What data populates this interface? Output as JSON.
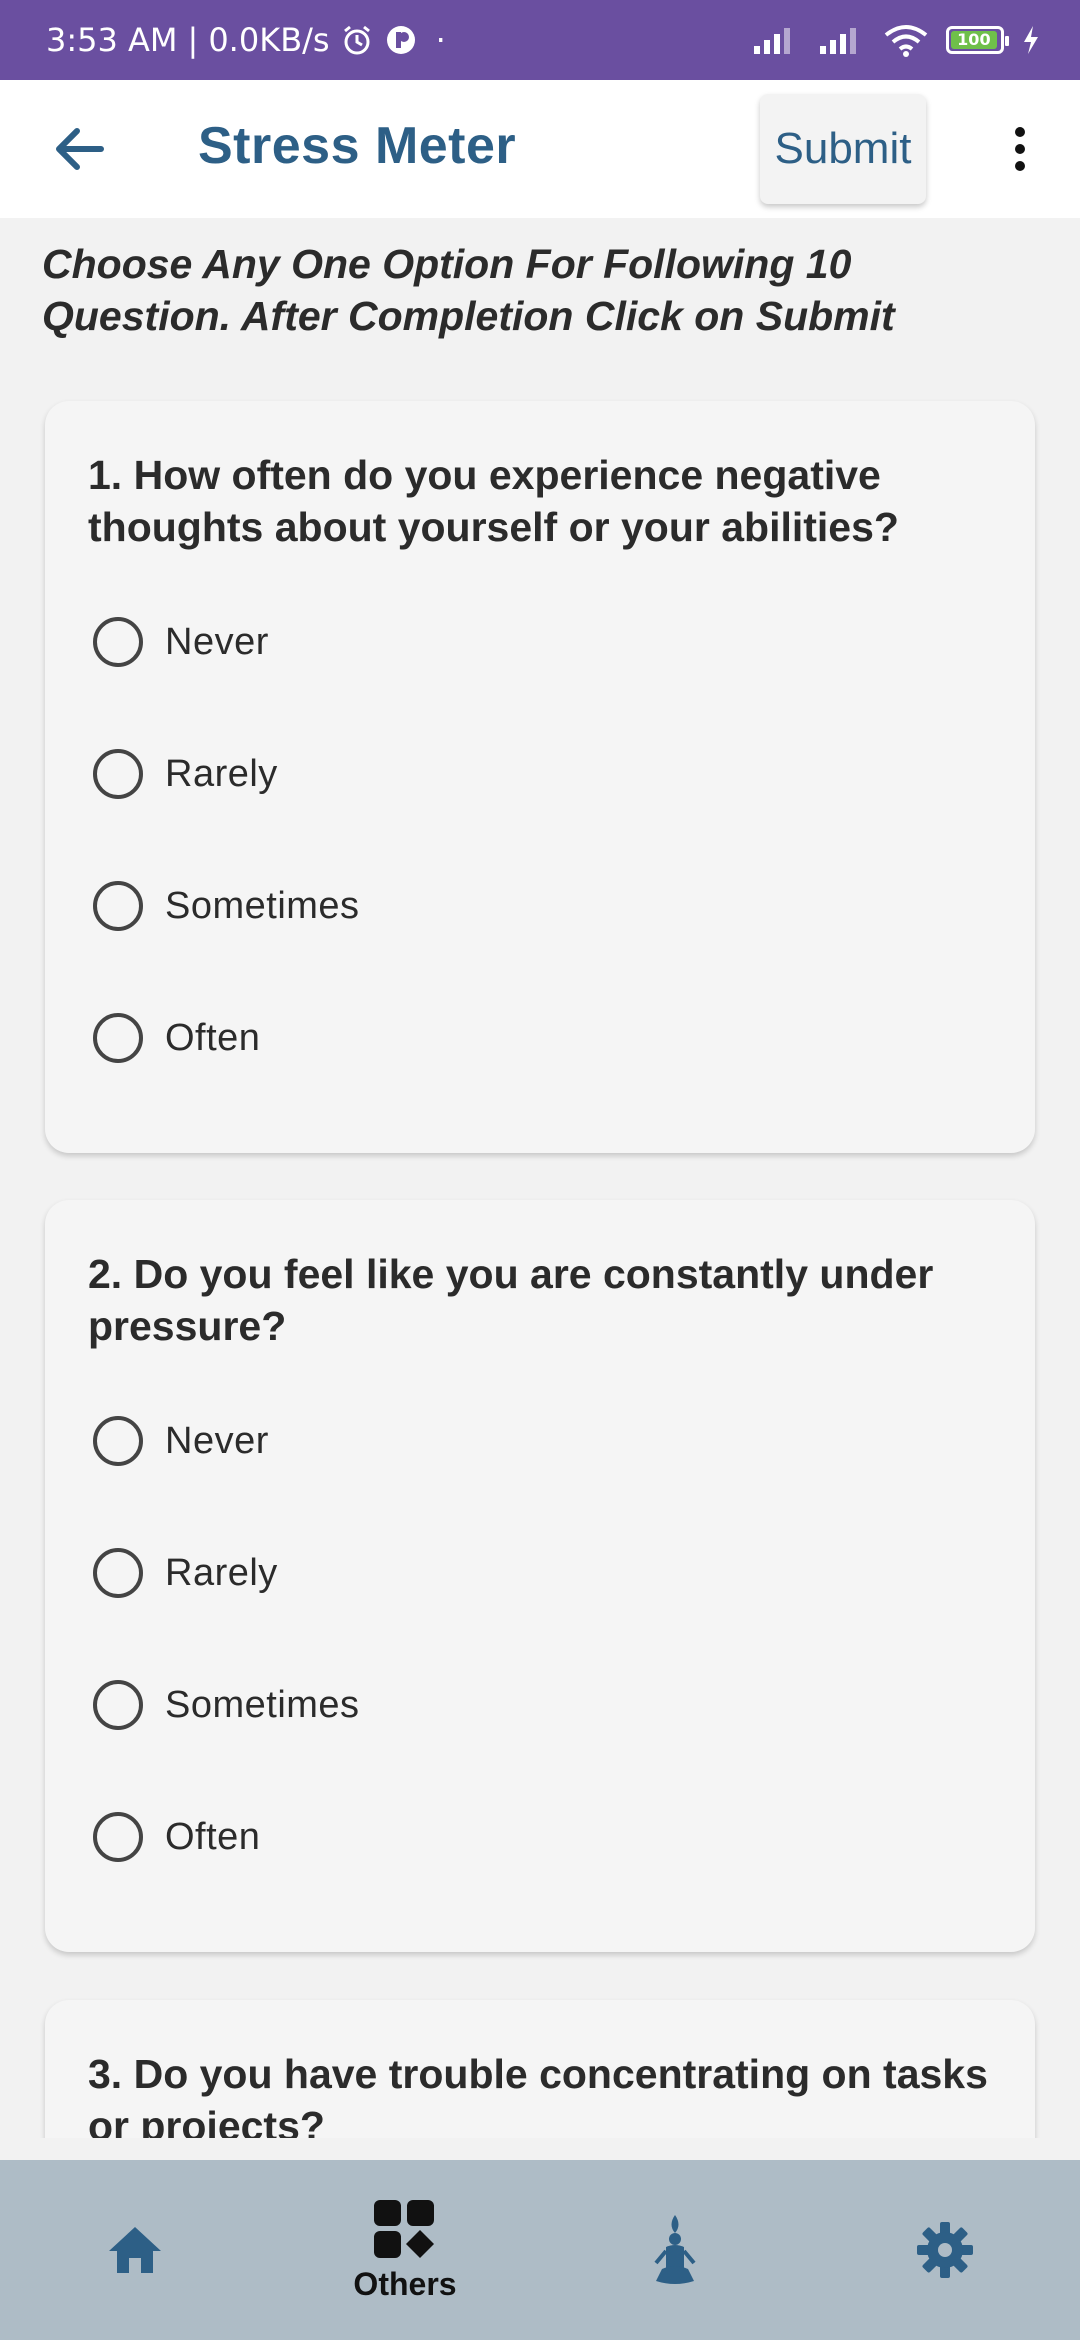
{
  "status_bar": {
    "time": "3:53 AM",
    "separator": "|",
    "speed": "0.0KB/s",
    "dot": "·",
    "battery_level": "100"
  },
  "app_bar": {
    "title": "Stress Meter",
    "submit_label": "Submit"
  },
  "instructions": "Choose Any One Option For Following 10 Question. After Completion Click on Submit",
  "questions": [
    {
      "text": "1. How often do you experience negative thoughts about yourself or your abilities?",
      "options": [
        "Never",
        "Rarely",
        "Sometimes",
        "Often"
      ]
    },
    {
      "text": "2. Do you feel like you are constantly under pressure?",
      "options": [
        "Never",
        "Rarely",
        "Sometimes",
        "Often"
      ]
    },
    {
      "text": "3. Do you have trouble concentrating on tasks or projects?",
      "options": []
    }
  ],
  "bottom_nav": {
    "items": [
      {
        "icon": "home-icon",
        "label": ""
      },
      {
        "icon": "grid-icon",
        "label": "Others"
      },
      {
        "icon": "meditation-icon",
        "label": ""
      },
      {
        "icon": "gear-icon",
        "label": ""
      }
    ]
  },
  "colors": {
    "status_bar": "#6a4fa0",
    "accent": "#2d5f86",
    "nav_background": "#aebcc6"
  }
}
